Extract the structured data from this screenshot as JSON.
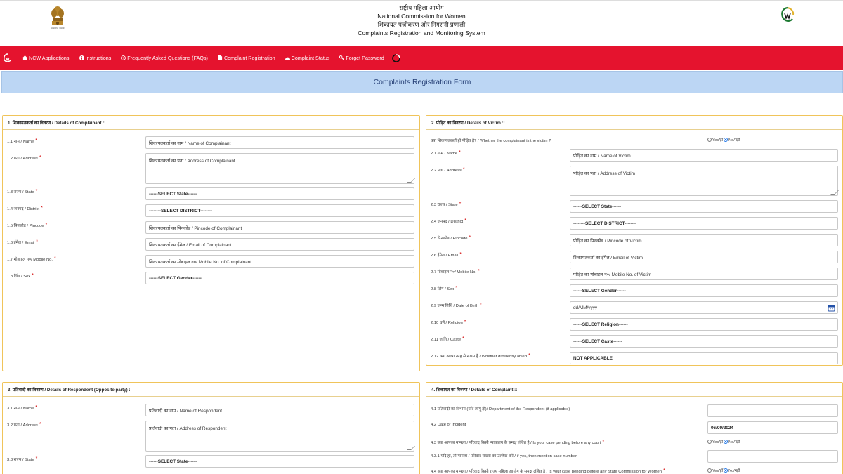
{
  "header": {
    "emblem_caption": "सत्यमेव जयते",
    "title_hi": "राष्ट्रीय महिला आयोग",
    "title_en": "National Commission for Women",
    "subtitle_hi": "शिकायत पंजीकरण और निगरानी प्रणाली",
    "subtitle_en": "Complaints Registration and Monitoring System"
  },
  "nav": {
    "items": [
      {
        "label": "NCW Applications",
        "icon": "home-icon"
      },
      {
        "label": "Instructions",
        "icon": "info-icon"
      },
      {
        "label": "Frequently Asked Questions (FAQs)",
        "icon": "question-icon"
      },
      {
        "label": "Complaint Registration",
        "icon": "document-icon"
      },
      {
        "label": "Complaint Status",
        "icon": "dashboard-icon"
      },
      {
        "label": "Forget Password",
        "icon": "key-icon"
      }
    ]
  },
  "form_title": "Complaints Registration Form",
  "complainant": {
    "heading": "1. शिकायतकर्ता का विवरण / Details of Complainant ::",
    "fields": [
      {
        "label": "1.1 नाम / Name",
        "value": "शिकायतकर्ता का  नाम / Name of Complainant"
      },
      {
        "label": "1.2 पता / Address",
        "value": "शिकायतकर्ता का पता / Address of Complainant"
      },
      {
        "label": "1.3 राज्य / State",
        "value": "------SELECT State------"
      },
      {
        "label": "1.4 जनपद / District",
        "value": "--------SELECT DISTRICT--------"
      },
      {
        "label": "1.5 पिनकोड / Pincode",
        "value": "शिकायतकर्ता का पिनकोड / Pincode  of Complainant"
      },
      {
        "label": "1.6 ईमेल / Email",
        "value": "शिकायतकर्ता का ईमेल / Email of Complainant"
      },
      {
        "label": "1.7 मोबाइल न०/ Mobile No.",
        "value": "शिकायतकर्ता का मोबाइल न०/ Mobile No. of Complainant"
      },
      {
        "label": "1.8 लिंग / Sex",
        "value": "------SELECT Gender------"
      }
    ]
  },
  "victim": {
    "heading": "2. पीड़ित का विवरण / Details of Victim ::",
    "question": "क्या शिकायतकर्ता ही पीड़ित है? / Whether the complainant is the victim ?",
    "radio_yes": "Yes/हाँ",
    "radio_no": "No/नहीं",
    "fields": [
      {
        "label": "2.1 नाम / Name",
        "value": "पीड़ित का  नाम / Name of Victim"
      },
      {
        "label": "2.2 पता / Address",
        "value": "पीड़ित का  पता / Address of Victim"
      },
      {
        "label": "2.3 राज्य / State",
        "value": "------SELECT State------"
      },
      {
        "label": "2.4 जनपद / District",
        "value": "--------SELECT DISTRICT--------"
      },
      {
        "label": "2.5 पिनकोड / Pincode",
        "value": "पीड़ित का पिनकोड / Pincode  of Victim"
      },
      {
        "label": "2.6 ईमेल / Email",
        "value": "शिकायतकर्ता का ईमेल / Email of Victim"
      },
      {
        "label": "2.7 मोबाइल न०/ Mobile No.",
        "value": "पीड़ित का मोबाइल न०/ Mobile No. of Victim"
      },
      {
        "label": "2.8 लिंग / Sex",
        "value": "------SELECT Gender------"
      },
      {
        "label": "2.9 जन्म तिथि / Date of Birth",
        "value": "dd/MM/yyyy"
      },
      {
        "label": "2.10 धर्म / Religion",
        "value": "------SELECT Religion------"
      },
      {
        "label": "2.11 जाति / Caste",
        "value": "------SELECT Caste------"
      },
      {
        "label": "2.12 क्या अलग तरह से सक्षम है / Whether differently abled",
        "value": "NOT APPLICABLE"
      }
    ]
  },
  "respondent": {
    "heading": "3. प्रतिवादी का विवरण / Details of Respondent (Opposite party) ::",
    "fields": [
      {
        "label": "3.1 नाम / Name",
        "value": "प्रतिवादी का  नाम / Name of Respondent"
      },
      {
        "label": "3.2 पता / Address",
        "value": "प्रतिवादी का पता / Address of Respondent"
      },
      {
        "label": "3.3 राज्य / State",
        "value": "------SELECT State------"
      }
    ]
  },
  "complaint": {
    "heading": "4. शिकायत का विवरण / Details of Complaint ::",
    "fields": [
      {
        "label": "4.1 प्रतिवादी का विभाग (यदि लागू हो)/ Department of the Respondent (if applicable)",
        "value": ""
      },
      {
        "label": "4.2 Date of Incident",
        "value": "06/09/2024"
      },
      {
        "label": "4.3 क्या आपका मामला / परिवाद किसी न्यायालय के समक्ष लंबित है / Is your case pending before any court",
        "value": ""
      },
      {
        "label": "4.3.1 यदि हाँ, तो मामला / परिवाद संख्या का उल्लेख करें / if yes, then mention case number",
        "value": ""
      },
      {
        "label": "4.4 क्या आपका मामला / परिवाद किसी राज्य महिला आयोग के समक्ष लंबित है / Is your case pending before any State Commission for Women",
        "value": ""
      }
    ],
    "radio_yes": "Yes/हाँ",
    "radio_no": "No/नहीं"
  }
}
